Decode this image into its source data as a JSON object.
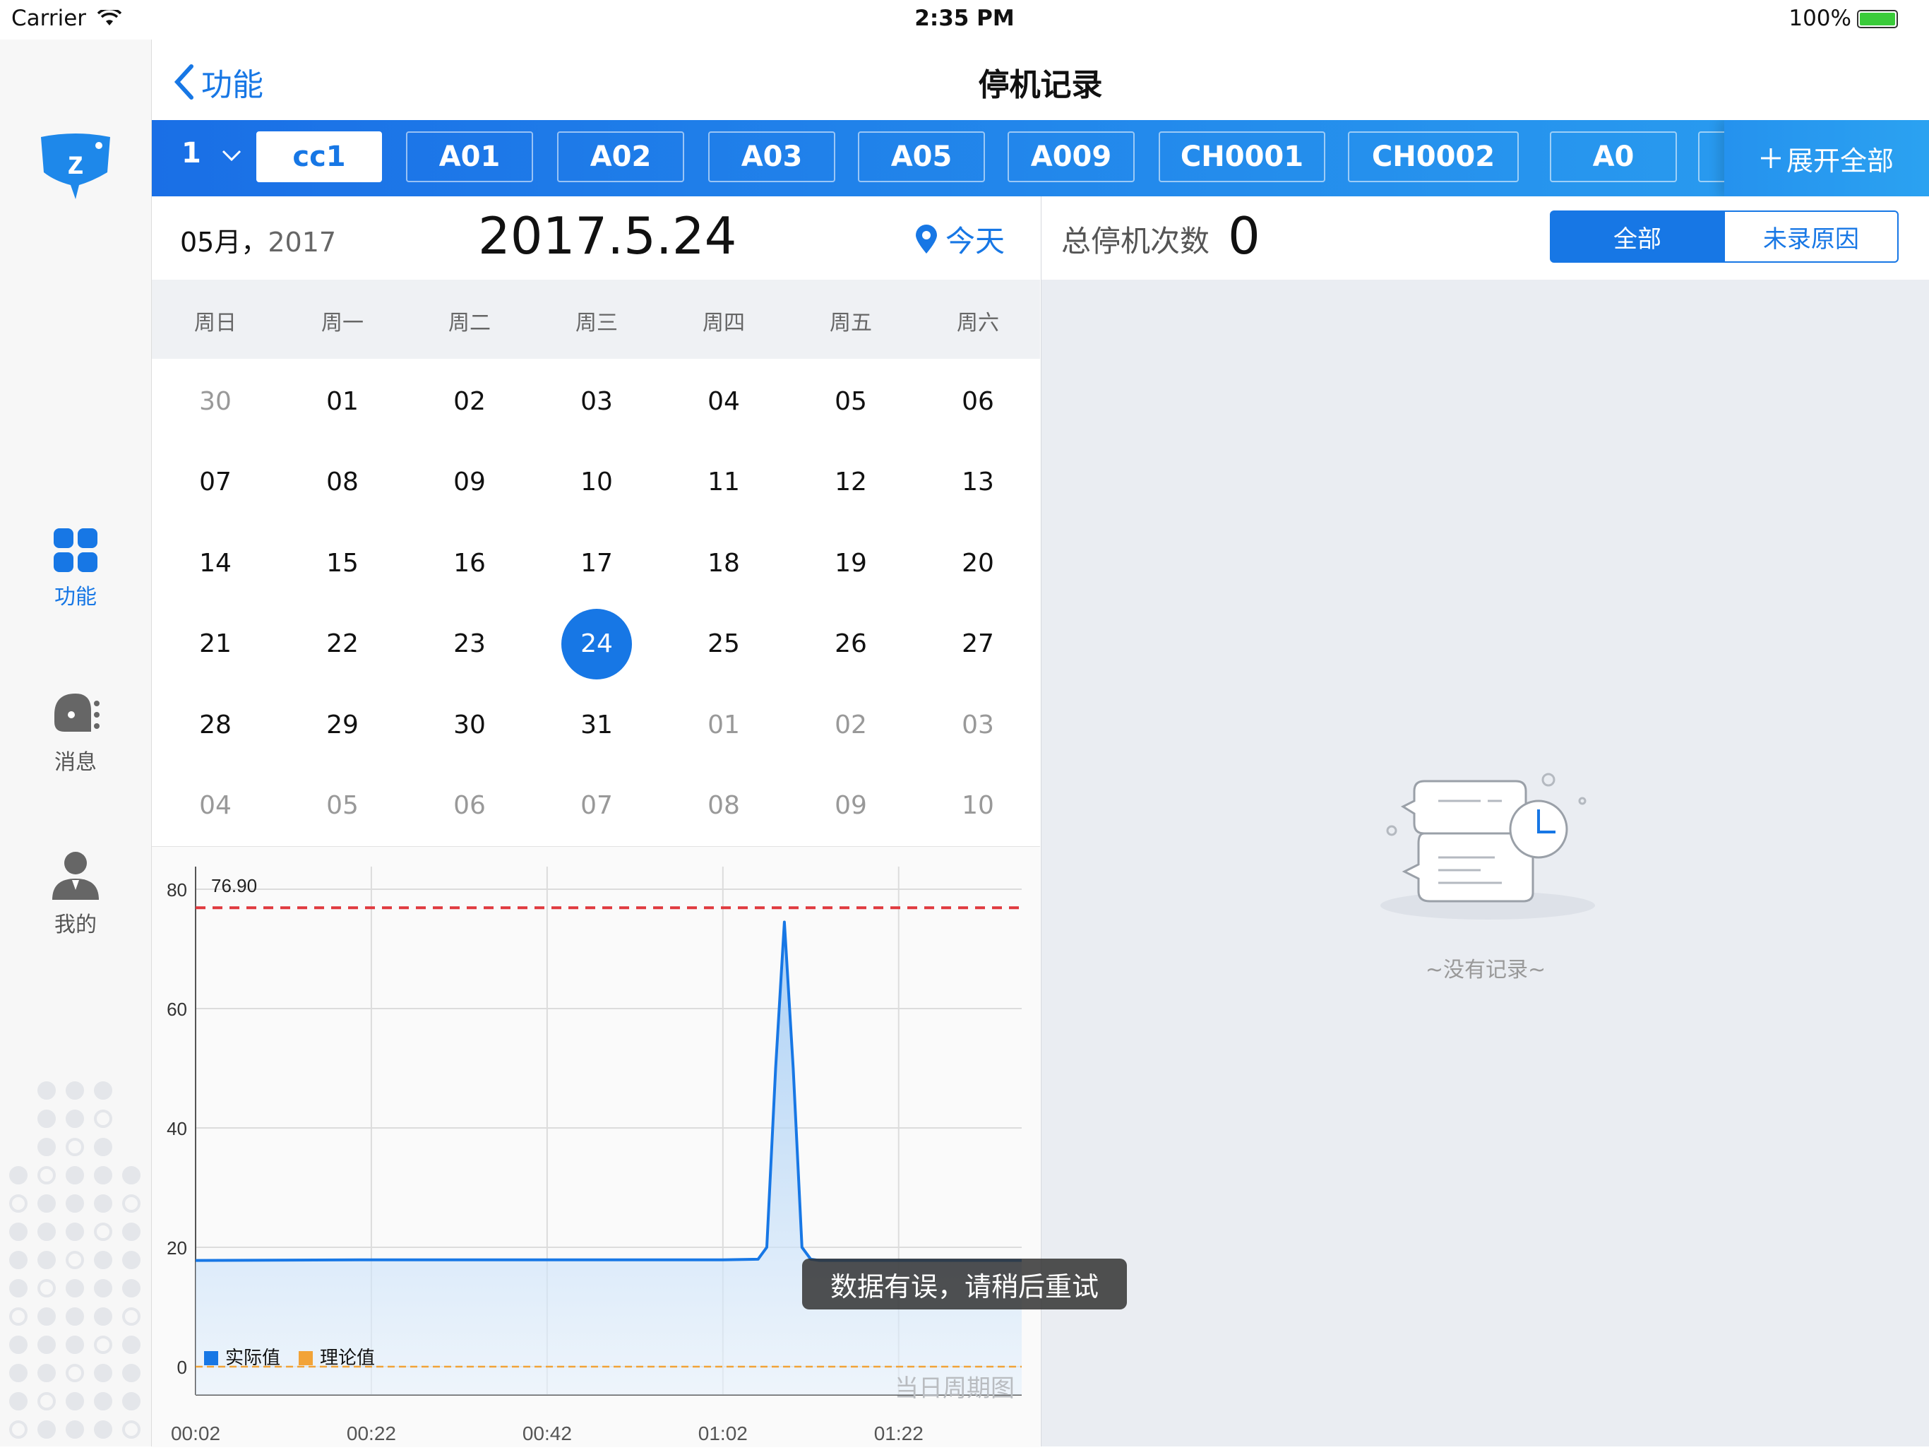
{
  "status_bar": {
    "carrier": "Carrier",
    "time": "2:35 PM",
    "battery": "100%"
  },
  "sidebar": {
    "items": [
      {
        "label": "功能",
        "icon": "grid-icon",
        "active": true
      },
      {
        "label": "消息",
        "icon": "message-icon",
        "active": false
      },
      {
        "label": "我的",
        "icon": "user-icon",
        "active": false
      }
    ]
  },
  "navbar": {
    "back_label": "功能",
    "title": "停机记录"
  },
  "tabs": {
    "group": "1",
    "items": [
      "cc1",
      "A01",
      "A02",
      "A03",
      "A05",
      "A009",
      "CH0001",
      "CH0002",
      "A0"
    ],
    "active_index": 0,
    "expand_label": "展开全部"
  },
  "calendar": {
    "month_label": "05月，",
    "year_label": "2017",
    "date_label": "2017.5.24",
    "today_label": "今天",
    "weekdays": [
      "周日",
      "周一",
      "周二",
      "周三",
      "周四",
      "周五",
      "周六"
    ],
    "weeks": [
      [
        "30",
        "01",
        "02",
        "03",
        "04",
        "05",
        "06"
      ],
      [
        "07",
        "08",
        "09",
        "10",
        "11",
        "12",
        "13"
      ],
      [
        "14",
        "15",
        "16",
        "17",
        "18",
        "19",
        "20"
      ],
      [
        "21",
        "22",
        "23",
        "24",
        "25",
        "26",
        "27"
      ],
      [
        "28",
        "29",
        "30",
        "31",
        "01",
        "02",
        "03"
      ],
      [
        "04",
        "05",
        "06",
        "07",
        "08",
        "09",
        "10"
      ]
    ],
    "selected": "24"
  },
  "chart_data": {
    "type": "area",
    "title": "当日周期图",
    "x_ticks": [
      "00:02",
      "00:22",
      "00:42",
      "01:02",
      "01:22"
    ],
    "y_ticks": [
      0,
      20,
      40,
      60,
      80
    ],
    "ylim": [
      0,
      80
    ],
    "xlim": [
      2,
      96
    ],
    "grid": true,
    "legend_placement": "bottom-left",
    "reference_line": {
      "value": 76.9,
      "label": "76.90",
      "color": "#e0393e"
    },
    "series": [
      {
        "name": "实际值",
        "color": "#1777e5",
        "x": [
          2,
          22,
          42,
          62,
          66,
          67,
          68,
          69,
          70,
          71,
          72,
          73,
          96
        ],
        "y": [
          17.8,
          17.9,
          17.9,
          17.9,
          18.0,
          20,
          50,
          74.5,
          50,
          20,
          18.0,
          17.8,
          17.8
        ]
      },
      {
        "name": "理论值",
        "color": "#f2a338",
        "x": [
          2,
          96
        ],
        "y": [
          0,
          0
        ]
      }
    ]
  },
  "toast": {
    "message": "数据有误，请稍后重试"
  },
  "right_panel": {
    "total_label": "总停机次数",
    "total_value": "0",
    "segments": [
      "全部",
      "未录原因"
    ],
    "active_segment": 0,
    "empty_text": "~没有记录~"
  },
  "colors": {
    "accent": "#1777e5",
    "tab_bg": "#1a6fe6",
    "panel_bg": "#eaedf2"
  }
}
